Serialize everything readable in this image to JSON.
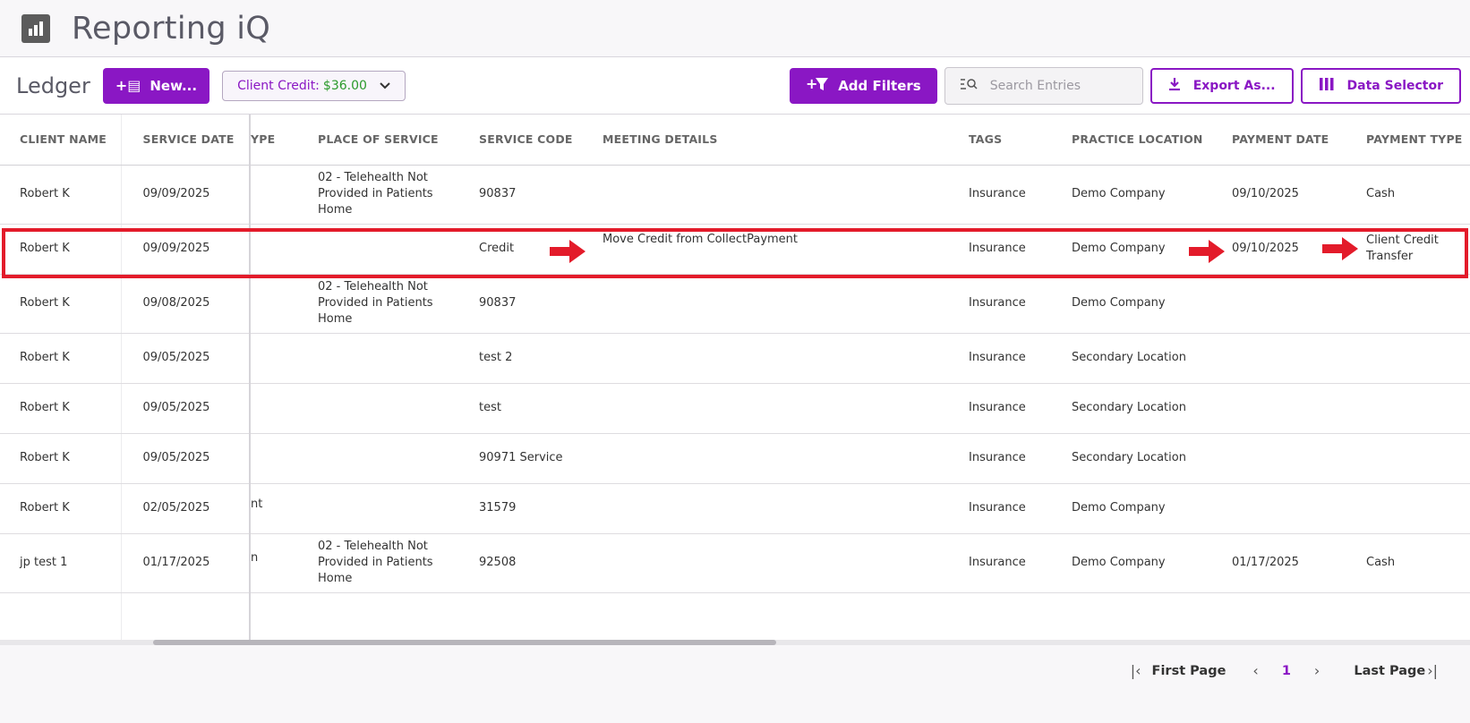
{
  "app": {
    "title": "Reporting iQ"
  },
  "toolbar": {
    "ledger_title": "Ledger",
    "new_label": "New...",
    "credit_label": "Client Credit:",
    "credit_amount": "$36.00",
    "add_filters_label": "Add Filters",
    "search_placeholder": "Search Entries",
    "export_label": "Export As...",
    "data_selector_label": "Data Selector"
  },
  "table": {
    "headers": [
      "CLIENT NAME",
      "SERVICE DATE",
      "YPE",
      "PLACE OF SERVICE",
      "SERVICE CODE",
      "MEETING DETAILS",
      "TAGS",
      "PRACTICE LOCATION",
      "PAYMENT DATE",
      "PAYMENT TYPE"
    ],
    "rows": [
      {
        "client": "Robert K",
        "date": "09/09/2025",
        "type": "",
        "place": "02 - Telehealth Not Provided in Patients Home",
        "code": "90837",
        "meeting": "",
        "tags": "Insurance",
        "location": "Demo Company",
        "pay_date": "09/10/2025",
        "pay_type": "Cash"
      },
      {
        "client": "Robert K",
        "date": "09/09/2025",
        "type": "",
        "place": "",
        "code": "Credit",
        "meeting": "Move Credit from CollectPayment",
        "tags": "Insurance",
        "location": "Demo Company",
        "pay_date": "09/10/2025",
        "pay_type": "Client Credit Transfer"
      },
      {
        "client": "Robert K",
        "date": "09/08/2025",
        "type": "",
        "place": "02 - Telehealth Not Provided in Patients Home",
        "code": "90837",
        "meeting": "",
        "tags": "Insurance",
        "location": "Demo Company",
        "pay_date": "",
        "pay_type": ""
      },
      {
        "client": "Robert K",
        "date": "09/05/2025",
        "type": "",
        "place": "",
        "code": "test 2",
        "meeting": "",
        "tags": "Insurance",
        "location": "Secondary Location",
        "pay_date": "",
        "pay_type": ""
      },
      {
        "client": "Robert K",
        "date": "09/05/2025",
        "type": "",
        "place": "",
        "code": "test",
        "meeting": "",
        "tags": "Insurance",
        "location": "Secondary Location",
        "pay_date": "",
        "pay_type": ""
      },
      {
        "client": "Robert K",
        "date": "09/05/2025",
        "type": "",
        "place": "",
        "code": "90971 Service",
        "meeting": "",
        "tags": "Insurance",
        "location": "Secondary Location",
        "pay_date": "",
        "pay_type": ""
      },
      {
        "client": "Robert K",
        "date": "02/05/2025",
        "type": "nt",
        "place": "",
        "code": "31579",
        "meeting": "",
        "tags": "Insurance",
        "location": "Demo Company",
        "pay_date": "",
        "pay_type": ""
      },
      {
        "client": "jp test 1",
        "date": "01/17/2025",
        "type": "n",
        "place": "02 - Telehealth Not Provided in Patients Home",
        "code": "92508",
        "meeting": "",
        "tags": "Insurance",
        "location": "Demo Company",
        "pay_date": "01/17/2025",
        "pay_type": "Cash"
      }
    ]
  },
  "pagination": {
    "first_label": "First Page",
    "current_page": "1",
    "last_label": "Last Page"
  },
  "colors": {
    "accent": "#8a17c4",
    "highlight": "#e31b2a",
    "credit_amount": "#2b9a2b"
  },
  "icons": [
    "bar-chart-icon",
    "new-entry-icon",
    "chevron-down-icon",
    "filter-icon",
    "search-icon",
    "download-icon",
    "columns-icon",
    "first-page-icon",
    "prev-page-icon",
    "next-page-icon",
    "last-page-icon",
    "red-arrow-annotation"
  ]
}
